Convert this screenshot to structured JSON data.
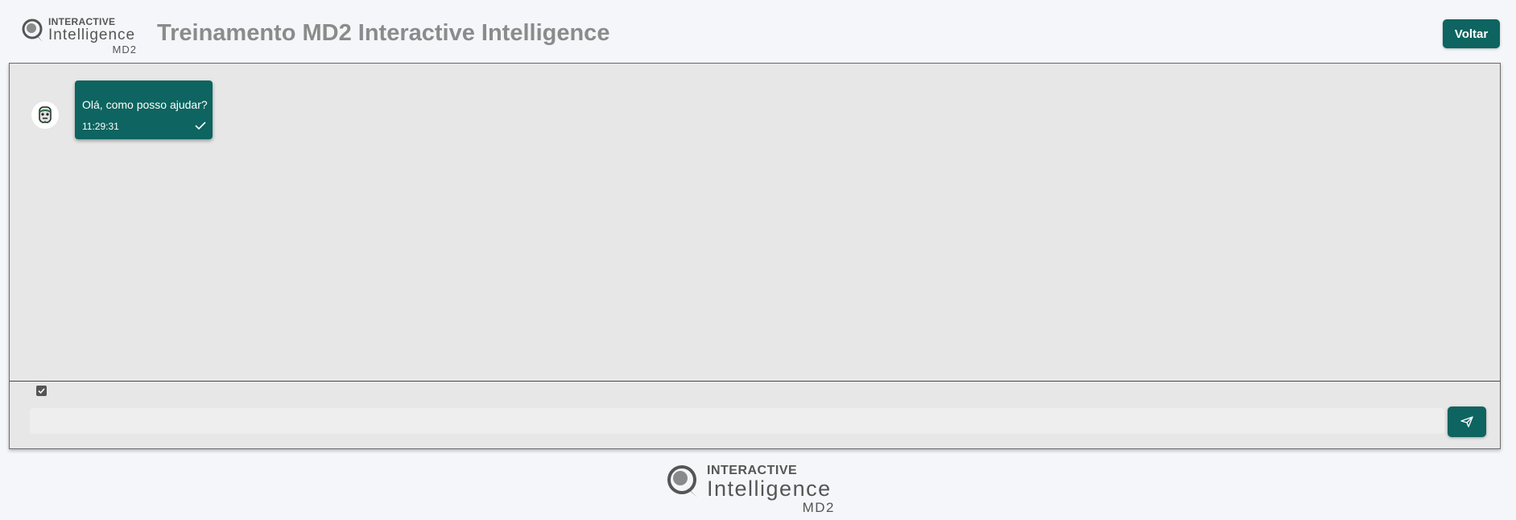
{
  "header": {
    "logo": {
      "line1": "INTERACTIVE",
      "line2": "Intelligence",
      "line3": "MD2"
    },
    "title": "Treinamento MD2 Interactive Intelligence",
    "back_label": "Voltar"
  },
  "chat": {
    "messages": [
      {
        "sender": "bot",
        "text": "Olá, como posso ajudar?",
        "time": "11:29:31",
        "status_icon": "check-icon"
      }
    ],
    "checkbox_checked": true,
    "input": {
      "value": "",
      "placeholder": ""
    },
    "send_icon": "send-icon"
  },
  "footer": {
    "logo": {
      "line1": "INTERACTIVE",
      "line2": "Intelligence",
      "line3": "MD2"
    }
  },
  "colors": {
    "accent": "#0d6460",
    "background": "#f5f6fa",
    "panel": "#e7e7e7",
    "title": "#8b8b8b"
  }
}
